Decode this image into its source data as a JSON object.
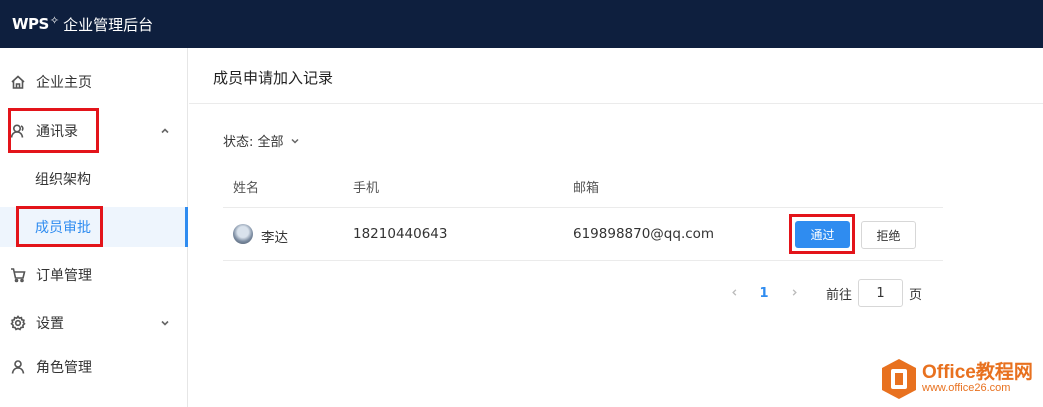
{
  "header": {
    "logo": "WPS",
    "app_title": "企业管理后台"
  },
  "sidebar": {
    "items": [
      {
        "label": "企业主页",
        "icon": "home-icon"
      },
      {
        "label": "通讯录",
        "icon": "contacts-icon",
        "expanded": true,
        "children": [
          {
            "label": "组织架构"
          },
          {
            "label": "成员审批",
            "active": true
          }
        ]
      },
      {
        "label": "订单管理",
        "icon": "cart-icon"
      },
      {
        "label": "设置",
        "icon": "gear-icon",
        "expanded": false
      },
      {
        "label": "角色管理",
        "icon": "user-icon"
      }
    ]
  },
  "main": {
    "title": "成员申请加入记录",
    "filter": {
      "label": "状态: 全部"
    },
    "table": {
      "columns": [
        "姓名",
        "手机",
        "邮箱"
      ],
      "rows": [
        {
          "name": "李达",
          "phone": "18210440643",
          "email": "619898870@qq.com",
          "approve_label": "通过",
          "reject_label": "拒绝"
        }
      ]
    },
    "pagination": {
      "current": "1",
      "goto_label": "前往",
      "goto_value": "1",
      "goto_suffix": "页"
    }
  },
  "colors": {
    "topbar": "#0e1f3e",
    "accent": "#2f8cf0",
    "highlight_box": "#e3141a",
    "watermark": "#e8711f"
  },
  "watermark": {
    "title": "Office教程网",
    "url": "www.office26.com"
  }
}
